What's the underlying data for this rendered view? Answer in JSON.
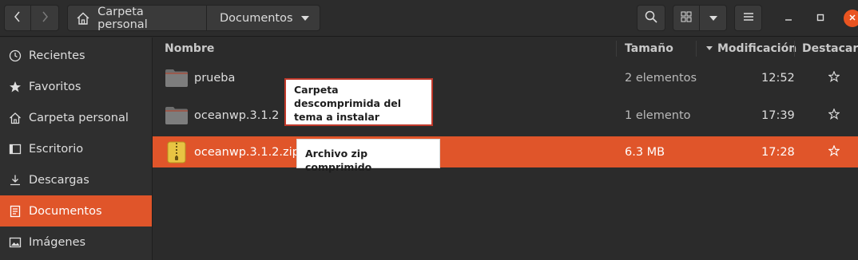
{
  "header": {
    "back_icon": "chevron-left-icon",
    "forward_icon": "chevron-right-icon",
    "path": [
      {
        "label": "Carpeta personal",
        "icon": "home-icon"
      },
      {
        "label": "Documentos",
        "icon": "dropdown-arrow-icon"
      }
    ],
    "search_icon": "search-icon",
    "view_icon": "grid-view-icon",
    "view_menu_icon": "dropdown-arrow-icon",
    "menu_icon": "hamburger-menu-icon",
    "window_controls": [
      "minimize-icon",
      "maximize-icon",
      "close-icon"
    ],
    "accent_color": "#e95420"
  },
  "sidebar": {
    "items": [
      {
        "label": "Recientes",
        "icon": "clock-icon"
      },
      {
        "label": "Favoritos",
        "icon": "star-icon"
      },
      {
        "label": "Carpeta personal",
        "icon": "home-icon"
      },
      {
        "label": "Escritorio",
        "icon": "desktop-icon"
      },
      {
        "label": "Descargas",
        "icon": "download-icon"
      },
      {
        "label": "Documentos",
        "icon": "document-icon",
        "active": true
      },
      {
        "label": "Imágenes",
        "icon": "image-icon"
      }
    ]
  },
  "columns": {
    "name": "Nombre",
    "size": "Tamaño",
    "modified": "Modificación",
    "starred": "Destacar"
  },
  "files": [
    {
      "name": "prueba",
      "size": "2 elementos",
      "modified": "12:52",
      "icon": "folder-icon"
    },
    {
      "name": "oceanwp.3.1.2",
      "size": "1 elemento",
      "modified": "17:39",
      "icon": "folder-icon"
    },
    {
      "name": "oceanwp.3.1.2.zip",
      "size": "6.3 MB",
      "modified": "17:28",
      "icon": "zip-archive-icon",
      "selected": true
    }
  ],
  "callouts": {
    "folder_note": "Carpeta descomprimida del tema a instalar",
    "zip_note": "Archivo zip comprimido"
  }
}
